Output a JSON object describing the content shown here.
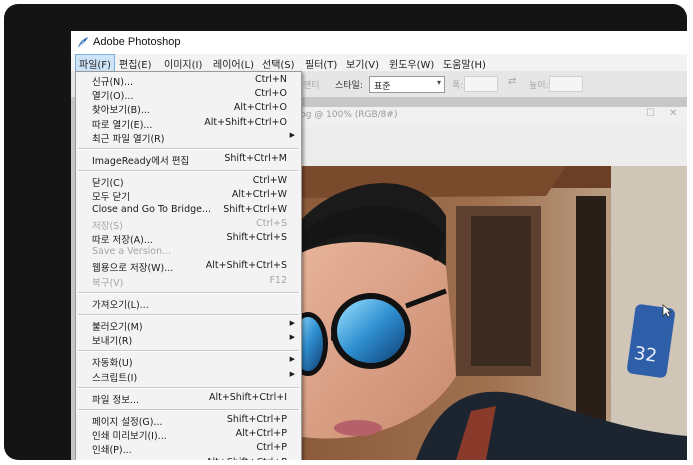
{
  "app": {
    "title": "Adobe Photoshop"
  },
  "menubar": [
    {
      "label": "파일(F)",
      "active": true
    },
    {
      "label": "편집(E)"
    },
    {
      "label": "이미지(I)"
    },
    {
      "label": "레이어(L)"
    },
    {
      "label": "선택(S)"
    },
    {
      "label": "필터(T)"
    },
    {
      "label": "보기(V)"
    },
    {
      "label": "윈도우(W)"
    },
    {
      "label": "도움말(H)"
    }
  ],
  "options_bar": {
    "antialias_label": "앤티",
    "style_label": "스타일:",
    "style_value": "표준",
    "width_label": "폭:",
    "height_label": "높이:"
  },
  "document": {
    "title": "pg @ 100% (RGB/8#)"
  },
  "file_menu": [
    {
      "label": "신규(N)...",
      "shortcut": "Ctrl+N"
    },
    {
      "label": "열기(O)...",
      "shortcut": "Ctrl+O"
    },
    {
      "label": "찾아보기(B)...",
      "shortcut": "Alt+Ctrl+O"
    },
    {
      "label": "따로 열기(E)...",
      "shortcut": "Alt+Shift+Ctrl+O"
    },
    {
      "label": "최근 파일 열기(R)",
      "submenu": true
    },
    {
      "separator": true
    },
    {
      "label": "ImageReady에서 편집",
      "shortcut": "Shift+Ctrl+M"
    },
    {
      "separator": true
    },
    {
      "label": "닫기(C)",
      "shortcut": "Ctrl+W"
    },
    {
      "label": "모두 닫기",
      "shortcut": "Alt+Ctrl+W"
    },
    {
      "label": "Close and Go To Bridge...",
      "shortcut": "Shift+Ctrl+W"
    },
    {
      "label": "저장(S)",
      "shortcut": "Ctrl+S",
      "disabled": true
    },
    {
      "label": "따로 저장(A)...",
      "shortcut": "Shift+Ctrl+S"
    },
    {
      "label": "Save a Version...",
      "disabled": true
    },
    {
      "label": "웹용으로 저장(W)...",
      "shortcut": "Alt+Shift+Ctrl+S"
    },
    {
      "label": "복구(V)",
      "shortcut": "F12",
      "disabled": true
    },
    {
      "separator": true
    },
    {
      "label": "가져오기(L)..."
    },
    {
      "separator": true
    },
    {
      "label": "불러오기(M)",
      "submenu": true
    },
    {
      "label": "보내기(R)",
      "submenu": true
    },
    {
      "separator": true
    },
    {
      "label": "자동화(U)",
      "submenu": true
    },
    {
      "label": "스크립트(I)",
      "submenu": true
    },
    {
      "separator": true
    },
    {
      "label": "파일 정보...",
      "shortcut": "Alt+Shift+Ctrl+I"
    },
    {
      "separator": true
    },
    {
      "label": "페이지 설정(G)...",
      "shortcut": "Shift+Ctrl+P"
    },
    {
      "label": "인쇄 미리보기(I)...",
      "shortcut": "Alt+Ctrl+P"
    },
    {
      "label": "인쇄(P)...",
      "shortcut": "Ctrl+P"
    },
    {
      "label": "한 부 인쇄(T)",
      "shortcut": "Alt+Shift+Ctrl+P"
    }
  ],
  "colors": {
    "menu_bg": "#f3f3f3",
    "menubar_active": "#cde3f7",
    "accent": "#2b6fb5"
  }
}
